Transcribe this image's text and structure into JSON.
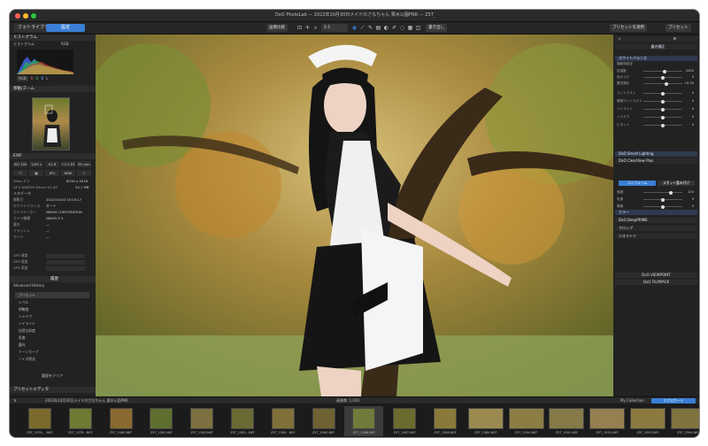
{
  "window": {
    "title": "DxO PhotoLab — 2022年10月30日メイドのさなちゃん 栗木公園PNR — Z5T_1581.NEF (1)"
  },
  "tabs": {
    "library": "フォトライブラリ",
    "edit": "設定"
  },
  "toolbar": {
    "compare": "画像比較",
    "export_button": "書き出し",
    "preset_apply": "プリセットを適用",
    "presets": "プリセット",
    "zoom": "1:1"
  },
  "left": {
    "histogram_title": "ヒストグラム",
    "histogram_value": "RGB",
    "navigator_title": "移動/ズーム",
    "exif_title": "EXIF",
    "exif_row1": [
      "ISO 100",
      "1/50 s",
      "f/1.8",
      "+0.3 EV",
      "85 mm"
    ],
    "exif_row2": [
      "JPG",
      "RAW"
    ],
    "file_name": "Nikon Z 5",
    "file_res": "6016 x 4016",
    "lens": "AF-S NIKKOR 85mm f/1.8G",
    "file_size": "24.1 MB",
    "meta_heading": "メタデータ",
    "meta": [
      {
        "k": "撮影日",
        "v": "2022/10/30 15:03:17"
      },
      {
        "k": "ホワイトバランス",
        "v": "オート"
      },
      {
        "k": "カメラメーカー",
        "v": "NIKON CORPORATION"
      },
      {
        "k": "カメラ機種",
        "v": "NIKON Z 5"
      },
      {
        "k": "露光",
        "v": "—"
      },
      {
        "k": "フラッシュ",
        "v": "—"
      },
      {
        "k": "モード",
        "v": "—"
      }
    ],
    "gps": [
      {
        "k": "GPS 緯度",
        "v": ""
      },
      {
        "k": "GPS 経度",
        "v": ""
      },
      {
        "k": "GPS 高度",
        "v": ""
      }
    ],
    "history_head": "履歴",
    "history_sub": "Advanced History",
    "history_items": [
      "プリセット",
      "レベル",
      "明瞭度",
      "シャドウ",
      "ハイライト",
      "自然な彩度",
      "彩度",
      "露光",
      "トーンカーブ",
      "ノイズ除去"
    ],
    "history_btn": "履歴をクリア",
    "preset_editor": "プリセットエディタ"
  },
  "right": {
    "panel_title": "露光補正",
    "sections": [
      "ホワイトバランス",
      "トーン",
      "DxO Smart Lighting",
      "DxO ClearView Plus",
      "カラー",
      "DxO DeepPRIME",
      "クロップ",
      "ジオメトリ"
    ],
    "wb_preset": "撮影時設定",
    "sliders": [
      {
        "lbl": "色温度",
        "val": "5200",
        "pos": 0.55
      },
      {
        "lbl": "色かぶり",
        "val": "0",
        "pos": 0.5
      },
      {
        "lbl": "露光補正",
        "val": "+0.30",
        "pos": 0.58
      },
      {
        "lbl": "コントラスト",
        "val": "0",
        "pos": 0.5
      },
      {
        "lbl": "微細コントラスト",
        "val": "0",
        "pos": 0.5
      },
      {
        "lbl": "ハイライト",
        "val": "0",
        "pos": 0.5
      },
      {
        "lbl": "シャドウ",
        "val": "0",
        "pos": 0.5
      },
      {
        "lbl": "ビネット",
        "val": "0",
        "pos": 0.5
      },
      {
        "lbl": "強度",
        "val": "100",
        "pos": 0.7
      },
      {
        "lbl": "彩度",
        "val": "0",
        "pos": 0.5
      },
      {
        "lbl": "輝度",
        "val": "0",
        "pos": 0.5
      }
    ],
    "smart_btn": "ユニフォーム",
    "smart_btn2": "スポット重み付け",
    "viewpoint": "DxO VIEWPOINT",
    "filmpack": "DxO FILMPACK"
  },
  "film": {
    "path": "2022年10月30日メイドのさなちゃん 栗木公園PNR",
    "count": "画像数: 1,043",
    "collections": "My Collection",
    "export": "エクスポート",
    "thumbs": [
      "Z5T_1578_...NEF",
      "Z5T_1579...NEF",
      "Z5T_1580.NEF",
      "Z5T_1581.NEF",
      "Z5T_1582.NEF",
      "Z5T_1583...NEF",
      "Z5T_1584...NEF",
      "Z5T_1585.NEF",
      "Z5T_1586.NEF",
      "Z5T_1587.NEF",
      "Z5T_1588.NEF",
      "Z5T_1589.NEF",
      "Z5T_1590.NEF",
      "Z5T_1591.NEF",
      "Z5T_1592.NEF",
      "Z5T_1593.NEF",
      "Z5T_1594.NEF"
    ]
  },
  "colors": {
    "accent": "#3a7fd6",
    "panel": "#222222",
    "bg": "#1f1f1f"
  }
}
